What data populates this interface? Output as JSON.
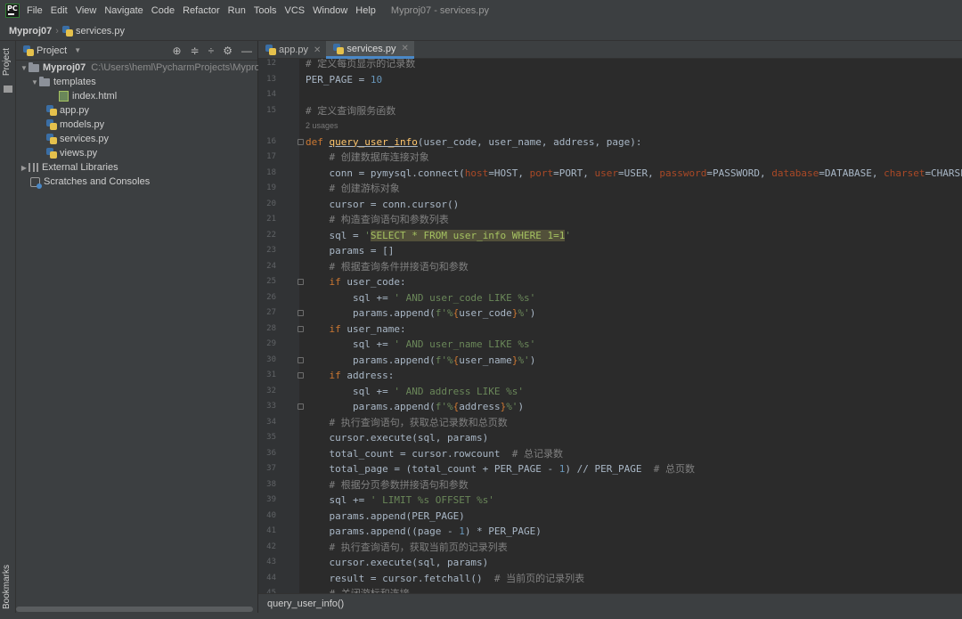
{
  "menu": {
    "items": [
      "File",
      "Edit",
      "View",
      "Navigate",
      "Code",
      "Refactor",
      "Run",
      "Tools",
      "VCS",
      "Window",
      "Help"
    ],
    "window_title": "Myproj07 - services.py"
  },
  "breadcrumb": {
    "project": "Myproj07",
    "file": "services.py"
  },
  "toolstrip": {
    "project_tab": "Project",
    "bookmarks_tab": "Bookmarks"
  },
  "project_panel": {
    "title": "Project",
    "root": {
      "name": "Myproj07",
      "path": "C:\\Users\\heml\\PycharmProjects\\Myproj07"
    },
    "items": [
      {
        "name": "templates",
        "kind": "folder"
      },
      {
        "name": "index.html",
        "kind": "html"
      },
      {
        "name": "app.py",
        "kind": "py"
      },
      {
        "name": "models.py",
        "kind": "py"
      },
      {
        "name": "services.py",
        "kind": "py"
      },
      {
        "name": "views.py",
        "kind": "py"
      },
      {
        "name": "External Libraries",
        "kind": "lib"
      },
      {
        "name": "Scratches and Consoles",
        "kind": "scratch"
      }
    ]
  },
  "tabs": [
    {
      "label": "app.py",
      "active": false
    },
    {
      "label": "services.py",
      "active": true
    }
  ],
  "editor": {
    "usages_hint": "2 usages",
    "line_numbers": [
      "12",
      "13",
      "14",
      "15",
      "16",
      "17",
      "18",
      "19",
      "20",
      "21",
      "22",
      "23",
      "24",
      "25",
      "26",
      "27",
      "28",
      "29",
      "30",
      "31",
      "32",
      "33",
      "34",
      "35",
      "36",
      "37",
      "38",
      "39",
      "40",
      "41",
      "42",
      "43",
      "44",
      "45"
    ],
    "lines": [
      "# 定义每页显示的记录数",
      "PER_PAGE = 10",
      "",
      "# 定义查询服务函数",
      "def query_user_info(user_code, user_name, address, page):",
      "    # 创建数据库连接对象",
      "    conn = pymysql.connect(host=HOST, port=PORT, user=USER, password=PASSWORD, database=DATABASE, charset=CHARSET)",
      "    # 创建游标对象",
      "    cursor = conn.cursor()",
      "    # 构造查询语句和参数列表",
      "    sql = 'SELECT * FROM user_info WHERE 1=1'",
      "    params = []",
      "    # 根据查询条件拼接语句和参数",
      "    if user_code:",
      "        sql += ' AND user_code LIKE %s'",
      "        params.append(f'%{user_code}%')",
      "    if user_name:",
      "        sql += ' AND user_name LIKE %s'",
      "        params.append(f'%{user_name}%')",
      "    if address:",
      "        sql += ' AND address LIKE %s'",
      "        params.append(f'%{address}%')",
      "    # 执行查询语句，获取总记录数和总页数",
      "    cursor.execute(sql, params)",
      "    total_count = cursor.rowcount  # 总记录数",
      "    total_page = (total_count + PER_PAGE - 1) // PER_PAGE  # 总页数",
      "    # 根据分页参数拼接语句和参数",
      "    sql += ' LIMIT %s OFFSET %s'",
      "    params.append(PER_PAGE)",
      "    params.append((page - 1) * PER_PAGE)",
      "    # 执行查询语句，获取当前页的记录列表",
      "    cursor.execute(sql, params)",
      "    result = cursor.fetchall()  # 当前页的记录列表",
      "    # 关闭游标和连接"
    ]
  },
  "statusbar": {
    "context": "query_user_info()"
  }
}
